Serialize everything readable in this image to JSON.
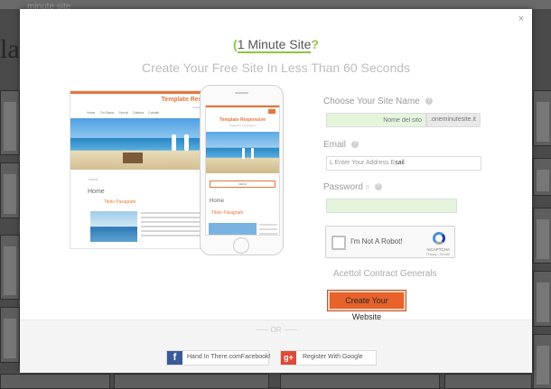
{
  "background": {
    "logo_text": "minute site",
    "big_letters": "la"
  },
  "modal": {
    "close_icon": "×",
    "logo": {
      "prefix": "(",
      "name": "1 Minute Site",
      "suffix": "?"
    },
    "headline": "Create Your Free Site In Less Than 60 Seconds",
    "preview": {
      "desktop": {
        "title": "Template Responsive",
        "subtitle": "Powered by 1minutesite.it",
        "nav": [
          "Home",
          "Chi Siamo",
          "Servizi",
          "Galleria",
          "Contatti"
        ],
        "breadcrumb": "Home",
        "page_heading": "Home",
        "paragraph_title": "Titolo Paragrafo"
      },
      "phone": {
        "title": "Template Responsive",
        "subtitle": "Powered by 1minutesite.it",
        "menu_label": "MENU",
        "page_heading": "Home",
        "paragraph_title": "Titolo Paragrafo"
      }
    },
    "form": {
      "site_name_label": "Choose Your Site Name",
      "site_name_placeholder": "Nome del sito",
      "site_domain_suffix": ".oneminutesite.it",
      "email_label": "Email",
      "email_placeholder": "L Enter Your Address E",
      "email_typed": "sail",
      "password_label": "Password",
      "password_marker": "!!",
      "help_glyph": "?",
      "recaptcha": {
        "label": "I'm Not A Robot!",
        "brand": "reCAPTCHA",
        "terms": "Privacy - Termini"
      },
      "contract_text": "Acettol Contract Generals",
      "submit_label": "Create Your Website"
    },
    "footer": {
      "or_text": "OR",
      "facebook_label": "Hand In There.comFacebook!",
      "facebook_glyph": "f",
      "google_label": "Register With Google",
      "google_glyph": "g+"
    }
  },
  "colors": {
    "accent_orange": "#e8622a",
    "input_green": "#e4f5dc",
    "facebook": "#3b5998",
    "google": "#dd4b39"
  }
}
